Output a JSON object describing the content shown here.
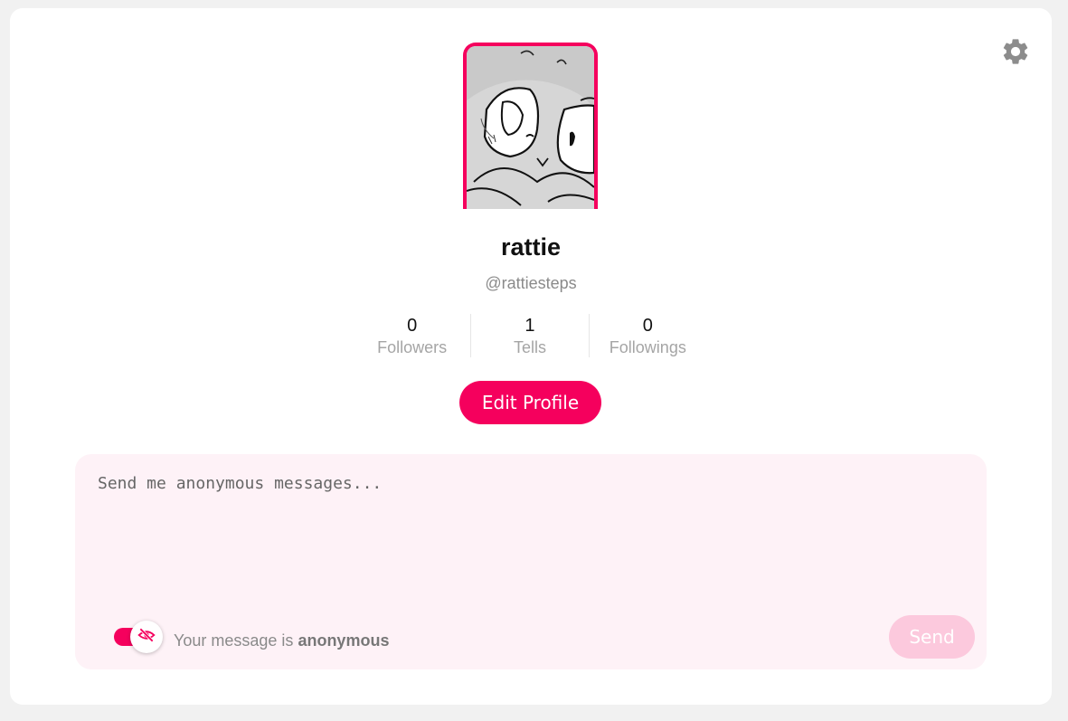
{
  "profile": {
    "name": "rattie",
    "handle": "@rattiesteps",
    "avatar_alt": "profile picture"
  },
  "stats": [
    {
      "count": "0",
      "label": "Followers"
    },
    {
      "count": "1",
      "label": "Tells"
    },
    {
      "count": "0",
      "label": "Followings"
    }
  ],
  "actions": {
    "edit_profile_label": "Edit Profile",
    "settings_icon": "gear-icon"
  },
  "composer": {
    "placeholder": "Send me anonymous messages...",
    "value": "",
    "anonymous_toggle_on": true,
    "anonymous_prefix": "Your message is",
    "anonymous_word": "anonymous",
    "send_label": "Send",
    "toggle_icon": "eye-off-icon"
  },
  "colors": {
    "accent": "#f5005d",
    "composer_bg": "#fef2f7",
    "send_disabled": "#fcc9dd"
  }
}
